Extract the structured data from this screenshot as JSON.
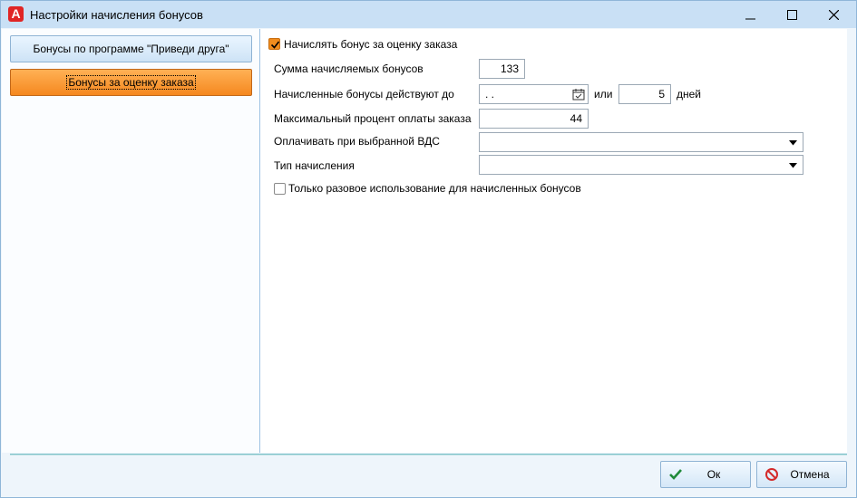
{
  "window": {
    "app_icon_letter": "A",
    "title": "Настройки начисления бонусов",
    "minimize_glyph": "—",
    "maximize_glyph": "☐",
    "close_glyph": "✕"
  },
  "nav": {
    "items": [
      {
        "label": "Бонусы по программе \"Приведи друга\"",
        "active": false
      },
      {
        "label": "Бонусы за оценку заказа",
        "active": true
      }
    ]
  },
  "form": {
    "accrue_checkbox_label": "Начислять бонус за оценку заказа",
    "accrue_checked": true,
    "bonus_amount_label": "Сумма начисляемых бонусов",
    "bonus_amount_value": "133",
    "valid_until_label": "Начисленные бонусы действуют до",
    "valid_until_value": ". .",
    "or_label": "или",
    "days_value": "5",
    "days_label": "дней",
    "max_percent_label": "Максимальный процент оплаты заказа",
    "max_percent_value": "44",
    "pay_vds_label": "Оплачивать при выбранной ВДС",
    "pay_vds_value": "",
    "accrual_type_label": "Тип начисления",
    "accrual_type_value": "",
    "one_time_label": "Только разовое использование для начисленных бонусов",
    "one_time_checked": false
  },
  "footer": {
    "ok_label": "Ок",
    "cancel_label": "Отмена"
  },
  "colors": {
    "accent_orange": "#f5881f",
    "title_bar": "#c9e0f5",
    "ok_icon": "#1f8a3a",
    "cancel_icon": "#d42a2a"
  },
  "icons": [
    "app-logo-icon",
    "minimize-icon",
    "maximize-icon",
    "close-icon",
    "checkmark-icon",
    "calendar-icon",
    "chevron-down-icon",
    "ok-check-icon",
    "cancel-prohibited-icon"
  ]
}
